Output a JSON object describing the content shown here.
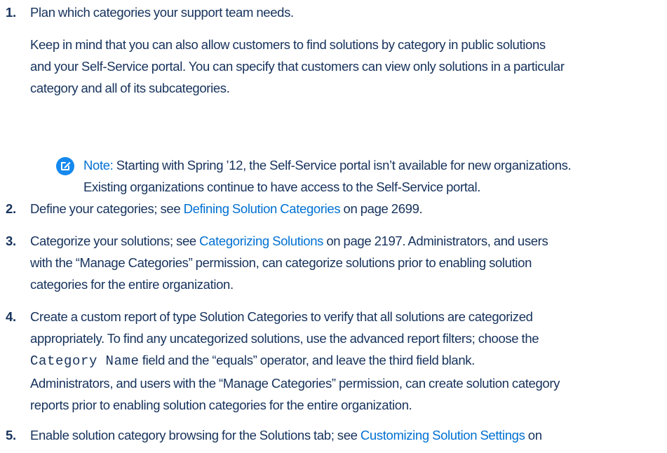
{
  "steps": [
    {
      "number": "1.",
      "text": "Plan which categories your support team needs.",
      "paragraph_lines": [
        "Keep in mind that you can also allow customers to find solutions by category in public solutions",
        "and your Self-Service portal. You can specify that customers can view only solutions in a particular",
        "category and all of its subcategories."
      ],
      "note": {
        "icon": "edit-note-icon",
        "label": "Note:",
        "line1": "Starting with Spring ’12, the Self-Service portal isn’t available for new organizations.",
        "line2": "Existing organizations continue to have access to the Self-Service portal."
      }
    },
    {
      "number": "2.",
      "pre": "Define your categories; see ",
      "link": "Defining Solution Categories",
      "post": " on page 2699."
    },
    {
      "number": "3.",
      "pre": "Categorize your solutions; see ",
      "link": "Categorizing Solutions",
      "post": " on page 2197. Administrators, and users",
      "line2": "with the “Manage Categories” permission, can categorize solutions prior to enabling solution",
      "line3": "categories for the entire organization."
    },
    {
      "number": "4.",
      "line1": "Create a custom report of type Solution Categories to verify that all solutions are categorized",
      "line2": "appropriately. To find any uncategorized solutions, use the advanced report filters; choose the",
      "code": "Category Name",
      "line3_post": " field and the “equals” operator, and leave the third field blank.",
      "line4": "Administrators, and users with the “Manage Categories” permission, can create solution category",
      "line5": "reports prior to enabling solution categories for the entire organization."
    },
    {
      "number": "5.",
      "pre": "Enable solution category browsing for the Solutions tab; see ",
      "link": "Customizing Solution Settings",
      "post": " on"
    }
  ]
}
